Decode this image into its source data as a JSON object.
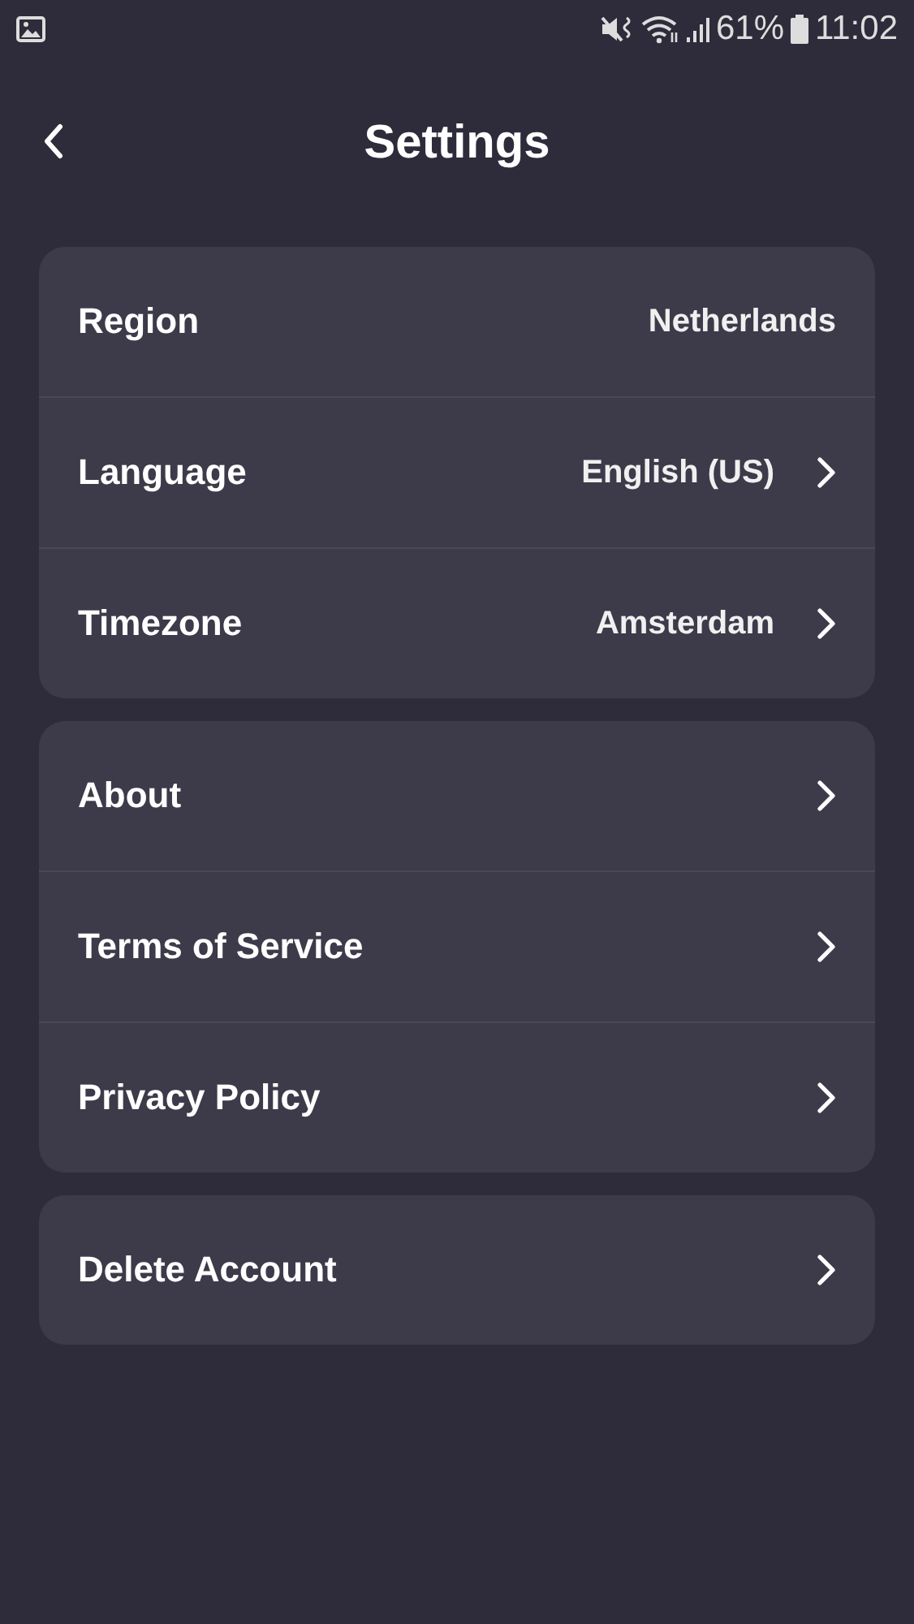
{
  "status_bar": {
    "battery": "61%",
    "time": "11:02"
  },
  "header": {
    "title": "Settings"
  },
  "groups": [
    {
      "rows": [
        {
          "label": "Region",
          "value": "Netherlands",
          "chevron": false
        },
        {
          "label": "Language",
          "value": "English (US)",
          "chevron": true
        },
        {
          "label": "Timezone",
          "value": "Amsterdam",
          "chevron": true
        }
      ]
    },
    {
      "rows": [
        {
          "label": "About",
          "chevron": true
        },
        {
          "label": "Terms of Service",
          "chevron": true
        },
        {
          "label": "Privacy Policy",
          "chevron": true
        }
      ]
    },
    {
      "rows": [
        {
          "label": "Delete Account",
          "chevron": true
        }
      ]
    }
  ]
}
